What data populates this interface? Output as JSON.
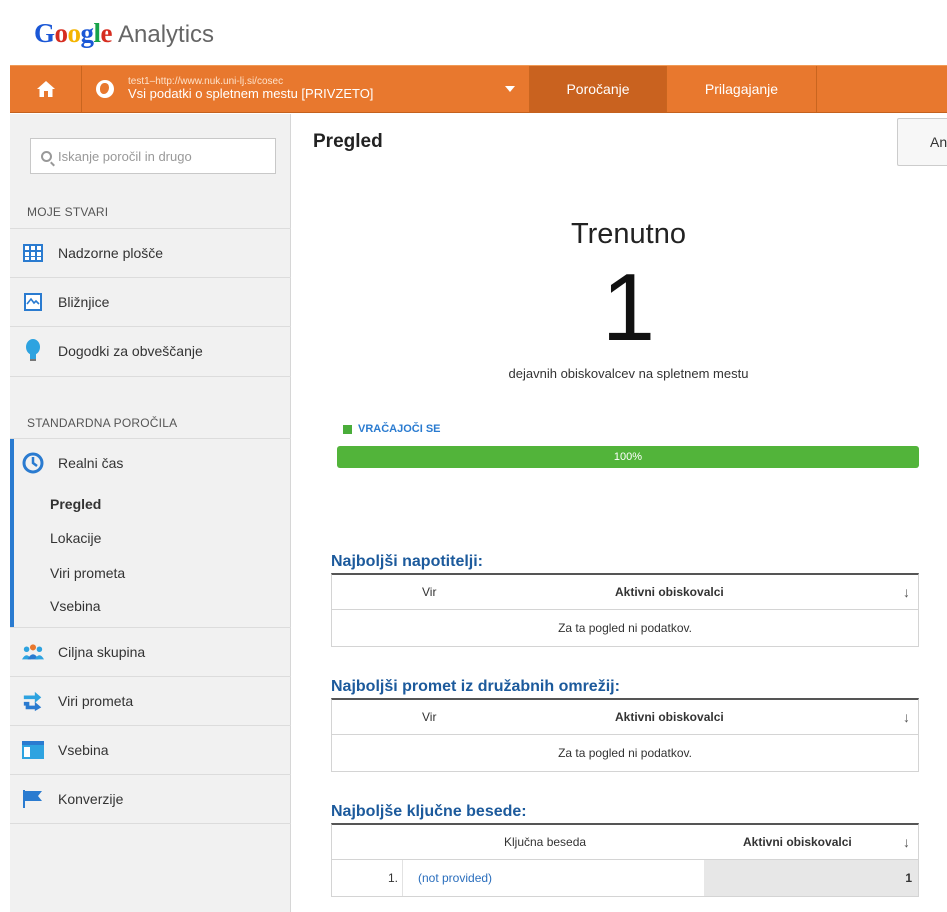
{
  "brand": {
    "google": "Google",
    "product": "Analytics"
  },
  "topbar": {
    "property_url": "test1–http://www.nuk.uni-lj.si/cosec",
    "property_name": "Vsi podatki o spletnem mestu [PRIVZETO]",
    "tab_reporting": "Poročanje",
    "tab_customization": "Prilagajanje",
    "accent": "#e8782e"
  },
  "sidebar": {
    "search_placeholder": "Iskanje poročil in drugo",
    "my_stuff_title": "MOJE STVARI",
    "my_stuff": [
      {
        "label": "Nadzorne plošče",
        "icon": "dashboard-icon"
      },
      {
        "label": "Bližnjice",
        "icon": "shortcuts-icon"
      },
      {
        "label": "Dogodki za obveščanje",
        "icon": "lightbulb-icon"
      }
    ],
    "standard_title": "STANDARDNA POROČILA",
    "realtime_label": "Realni čas",
    "realtime_sub": [
      "Pregled",
      "Lokacije",
      "Viri prometa",
      "Vsebina"
    ],
    "reports": [
      {
        "label": "Ciljna skupina",
        "icon": "audience-icon"
      },
      {
        "label": "Viri prometa",
        "icon": "traffic-icon"
      },
      {
        "label": "Vsebina",
        "icon": "content-icon"
      },
      {
        "label": "Konverzije",
        "icon": "flag-icon"
      }
    ]
  },
  "main": {
    "title": "Pregled",
    "corner_button": "An",
    "now_label": "Trenutno",
    "now_count": "1",
    "now_desc": "dejavnih obiskovalcev na spletnem mestu",
    "legend_label": "VRAČAJOČI SE",
    "progress_pct": 100,
    "progress_label": "100%",
    "referrers": {
      "title": "Najboljši napotitelji:",
      "col_source": "Vir",
      "col_active": "Aktivni obiskovalci",
      "empty": "Za ta pogled ni podatkov."
    },
    "social": {
      "title": "Najboljši promet iz družabnih omrežij:",
      "col_source": "Vir",
      "col_active": "Aktivni obiskovalci",
      "empty": "Za ta pogled ni podatkov."
    },
    "keywords": {
      "title": "Najboljše ključne besede:",
      "col_keyword": "Ključna beseda",
      "col_active": "Aktivni obiskovalci",
      "rows": [
        {
          "num": "1.",
          "keyword": "(not provided)",
          "value": "1"
        }
      ]
    },
    "sort_arrow": "↓"
  }
}
